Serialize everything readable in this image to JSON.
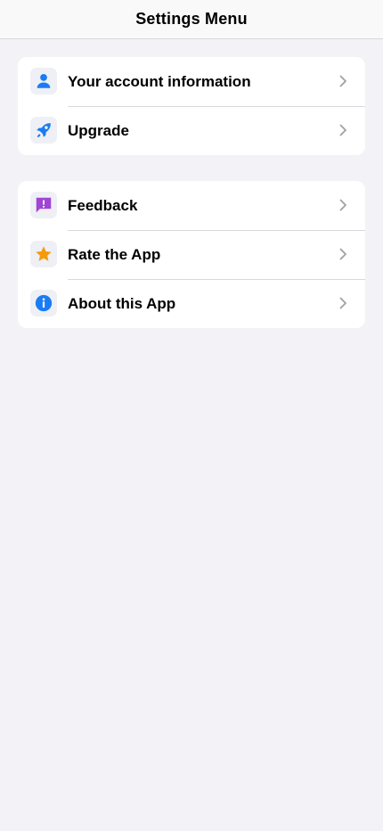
{
  "header": {
    "title": "Settings Menu"
  },
  "sections": [
    {
      "items": [
        {
          "label": "Your account information",
          "icon": "person-icon",
          "color": "#1a7cf5"
        },
        {
          "label": "Upgrade",
          "icon": "rocket-icon",
          "color": "#1a7cf5"
        }
      ]
    },
    {
      "items": [
        {
          "label": "Feedback",
          "icon": "message-alert-icon",
          "color": "#a045d4"
        },
        {
          "label": "Rate the App",
          "icon": "star-icon",
          "color": "#f59a0c"
        },
        {
          "label": "About this App",
          "icon": "info-icon",
          "color": "#1a7cf5"
        }
      ]
    }
  ],
  "colors": {
    "background": "#f2f2f7",
    "card": "#ffffff",
    "separator": "#d9d9de",
    "chevron": "#a0a0a6"
  }
}
